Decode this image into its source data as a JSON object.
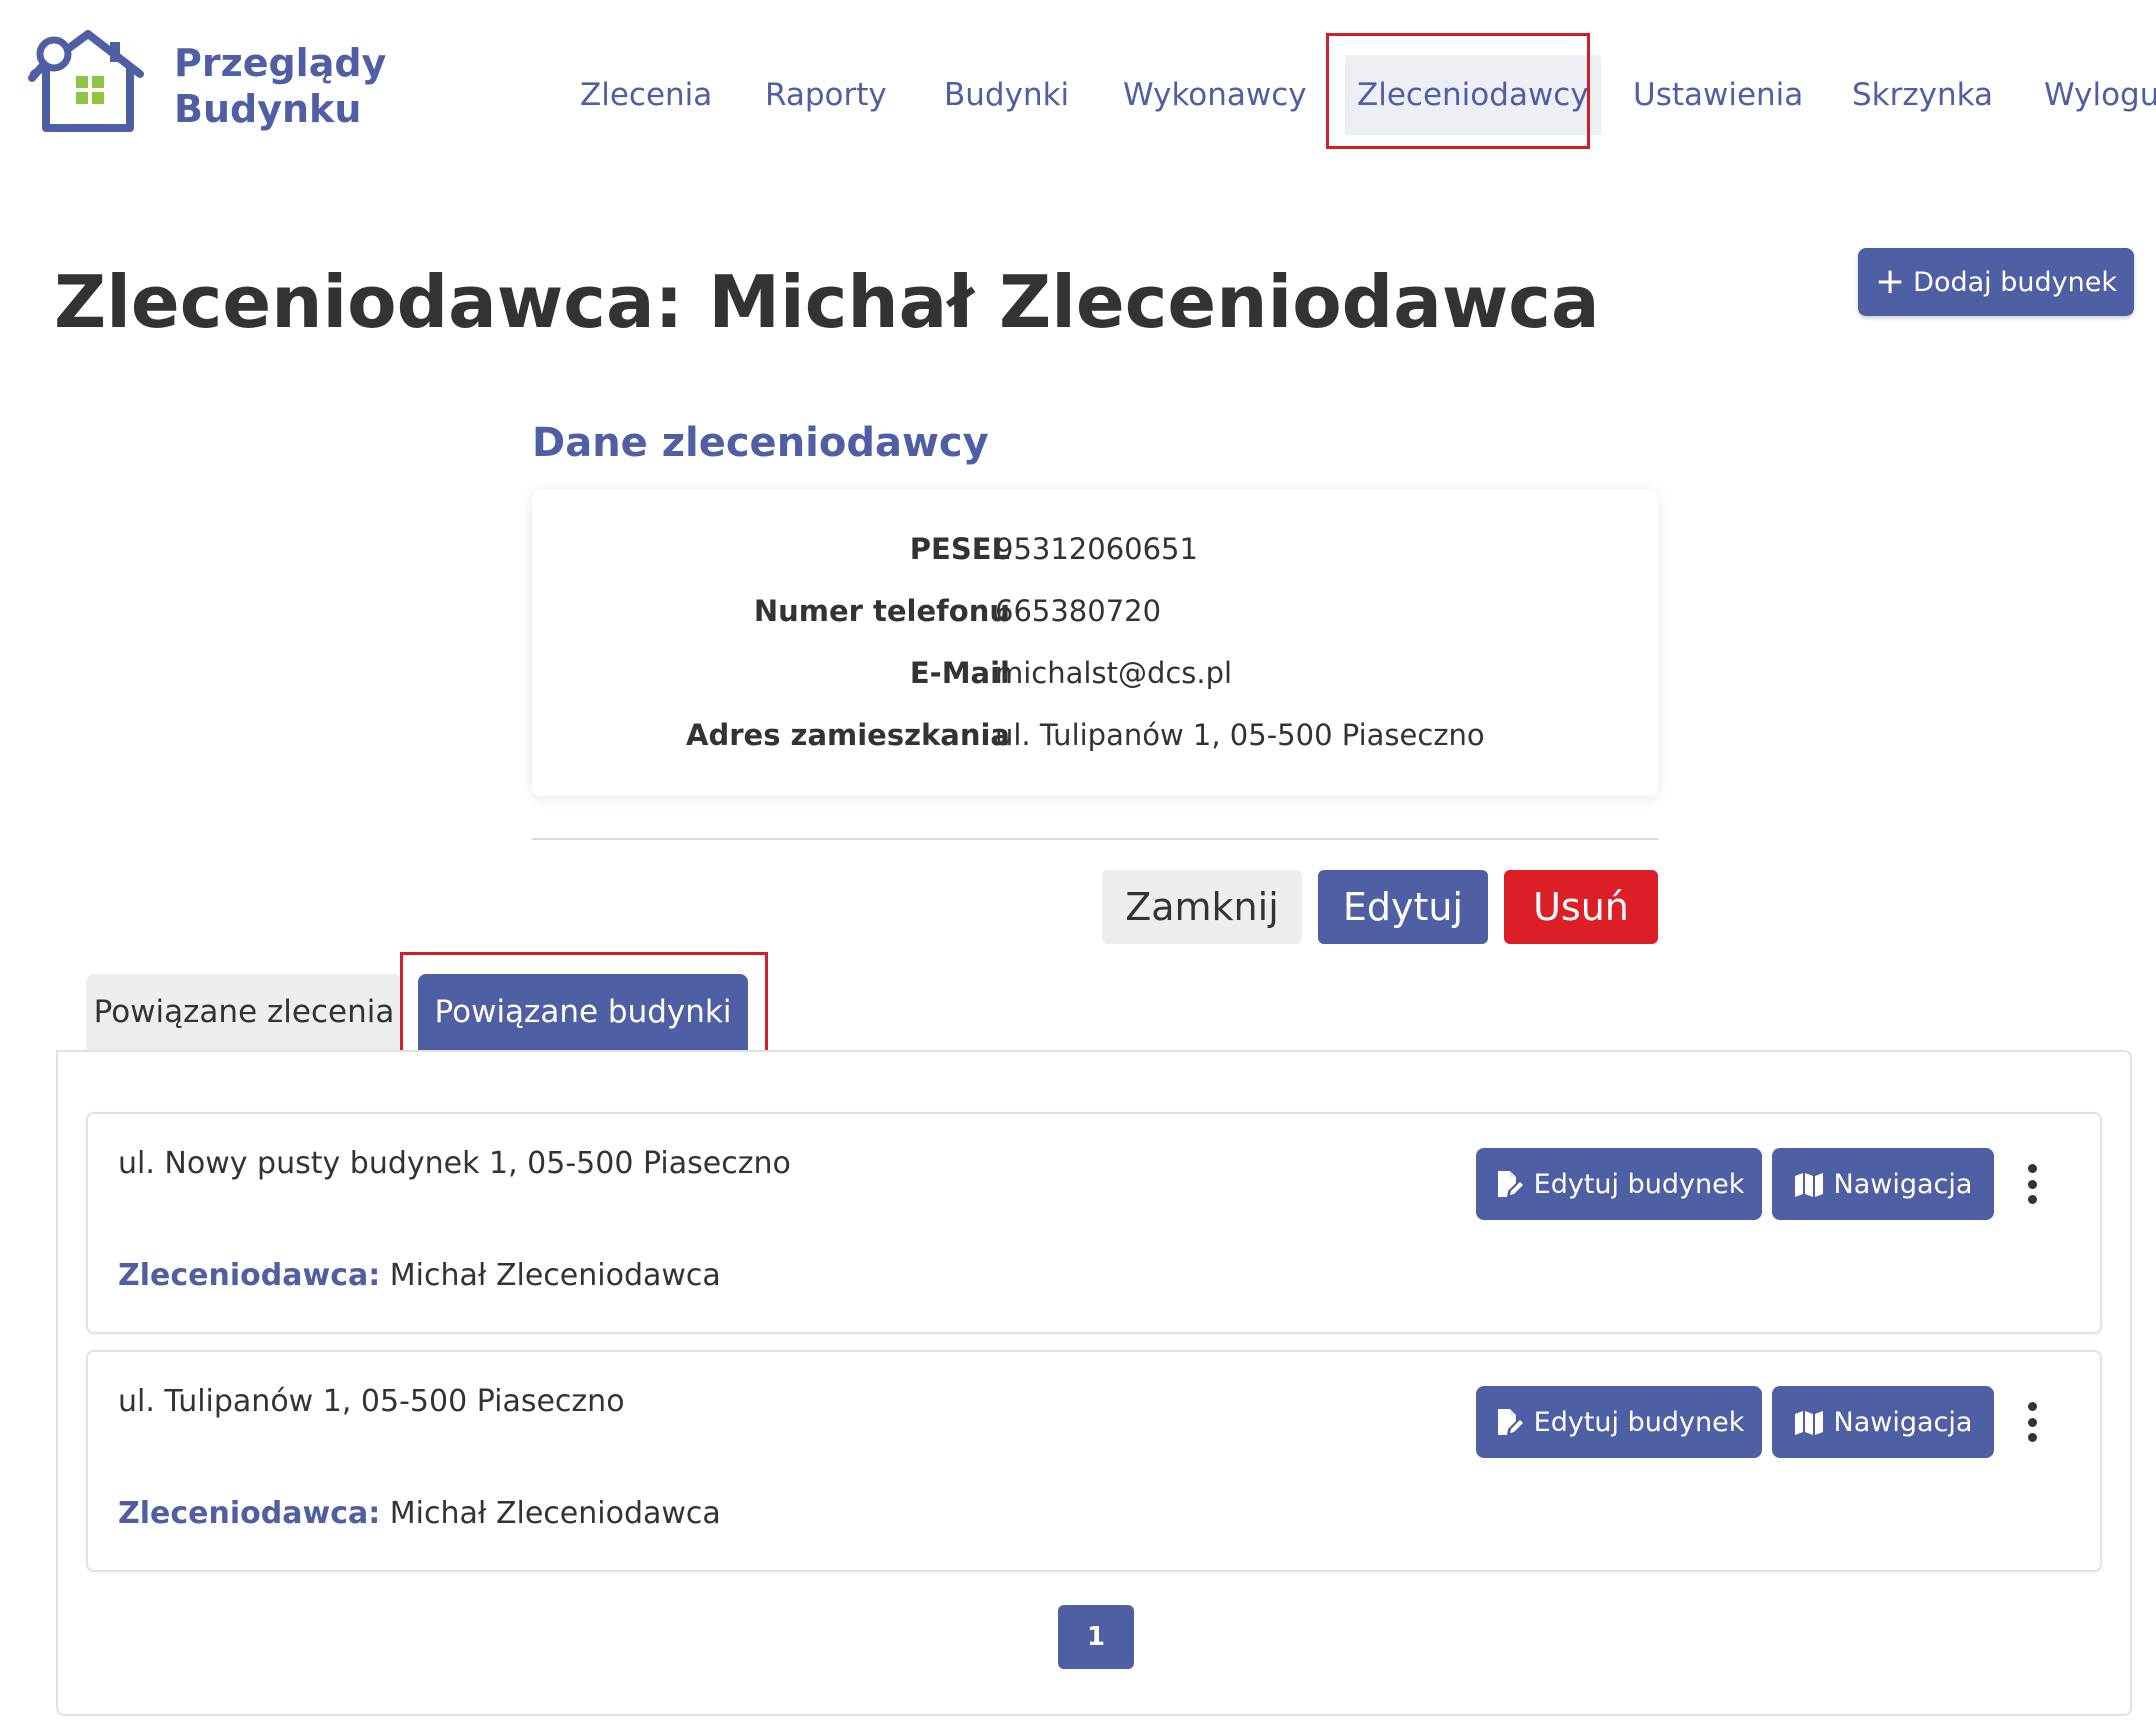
{
  "app": {
    "brand_line1": "Przeglądy",
    "brand_line2": "Budynku",
    "accent_color": "#4f5fa3",
    "logo_icon": "house-magnifier-icon"
  },
  "nav": {
    "items": [
      {
        "label": "Zlecenia"
      },
      {
        "label": "Raporty"
      },
      {
        "label": "Budynki"
      },
      {
        "label": "Wykonawcy"
      },
      {
        "label": "Zleceniodawcy",
        "active": true
      },
      {
        "label": "Ustawienia"
      },
      {
        "label": "Skrzynka"
      },
      {
        "label": "Wyloguj"
      }
    ]
  },
  "page": {
    "title": "Zleceniodawca: Michał Zleceniodawca",
    "add_button_icon": "plus-icon",
    "add_button_label": "Dodaj budynek"
  },
  "client": {
    "section_title": "Dane zleceniodawcy",
    "fields": [
      {
        "label": "PESEL",
        "value": "95312060651"
      },
      {
        "label": "Numer telefonu",
        "value": "665380720"
      },
      {
        "label": "E-Mail",
        "value": "michalst@dcs.pl"
      },
      {
        "label": "Adres zamieszkania",
        "value": "ul. Tulipanów 1, 05-500 Piaseczno"
      }
    ]
  },
  "actions": {
    "close_label": "Zamknij",
    "edit_label": "Edytuj",
    "delete_label": "Usuń",
    "delete_color": "#dc1f26"
  },
  "tabs": {
    "orders_label": "Powiązane zlecenia",
    "buildings_label": "Powiązane budynki",
    "active": "buildings"
  },
  "buildings": [
    {
      "address": "ul. Nowy pusty budynek 1, 05-500 Piaseczno",
      "client_label": "Zleceniodawca:",
      "client_name": "Michał Zleceniodawca",
      "edit_label": "Edytuj budynek",
      "edit_icon": "file-edit-icon",
      "nav_label": "Nawigacja",
      "nav_icon": "map-icon",
      "menu_icon": "kebab-menu-icon"
    },
    {
      "address": "ul. Tulipanów 1, 05-500 Piaseczno",
      "client_label": "Zleceniodawca:",
      "client_name": "Michał Zleceniodawca",
      "edit_label": "Edytuj budynek",
      "edit_icon": "file-edit-icon",
      "nav_label": "Nawigacja",
      "nav_icon": "map-icon",
      "menu_icon": "kebab-menu-icon"
    }
  ],
  "pagination": {
    "current": "1"
  }
}
